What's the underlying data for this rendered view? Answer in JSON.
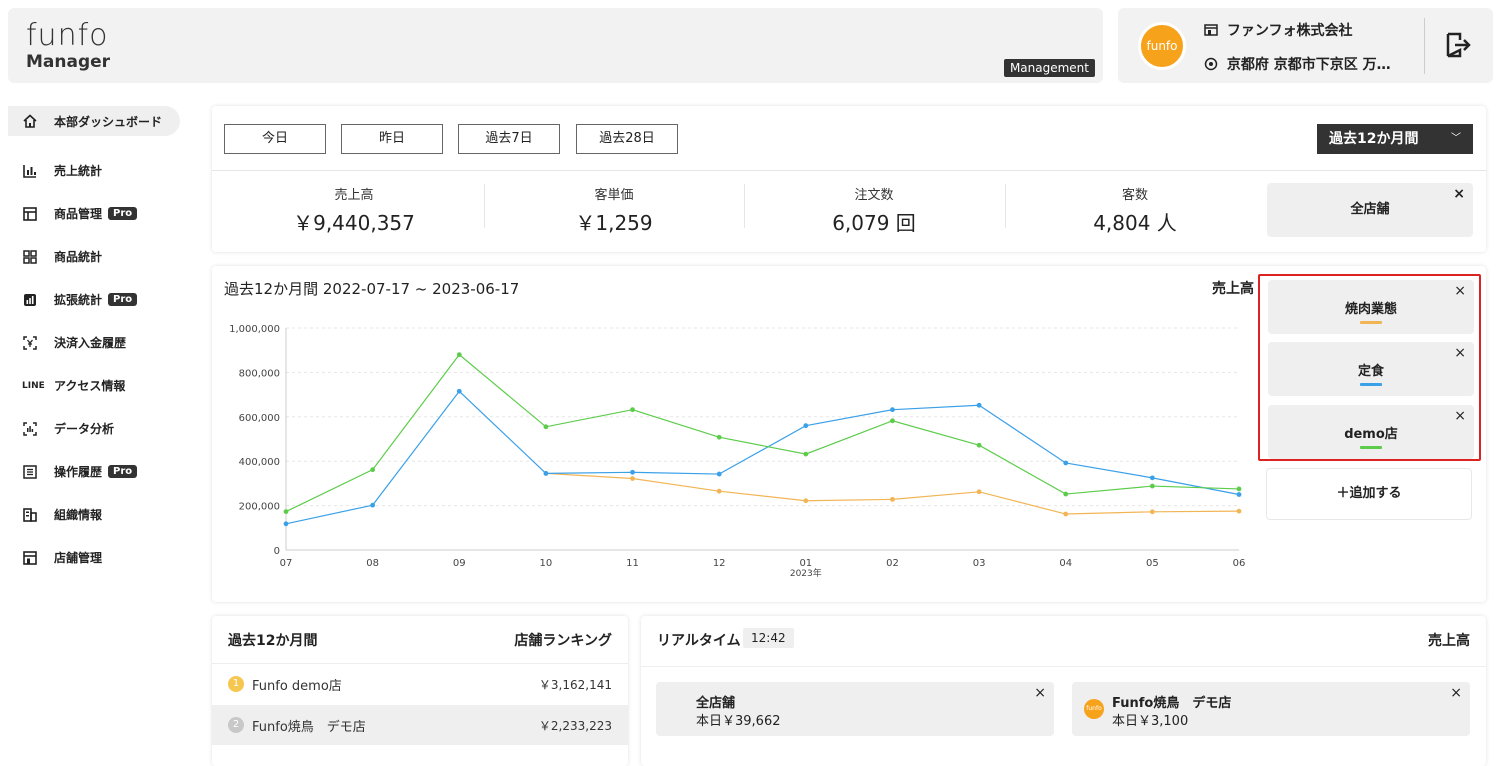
{
  "header": {
    "logo_word": "funfo",
    "logo_sub": "Manager",
    "mode_badge": "Management",
    "avatar_text": "funfo",
    "company": "ファンフォ株式会社",
    "address": "京都府 京都市下京区 万…"
  },
  "sidebar": {
    "items": [
      {
        "label": "本部ダッシュボード",
        "icon": "home-icon",
        "active": true
      },
      {
        "label": "売上統計",
        "icon": "bar-chart-icon"
      },
      {
        "label": "商品管理",
        "icon": "layout-icon",
        "badge": "Pro"
      },
      {
        "label": "商品統計",
        "icon": "grid-icon"
      },
      {
        "label": "拡張統計",
        "icon": "stats-icon",
        "badge": "Pro"
      },
      {
        "label": "決済入金履歴",
        "icon": "payment-icon"
      },
      {
        "label": "アクセス情報",
        "icon": "line-icon",
        "icon_text": "LINE"
      },
      {
        "label": "データ分析",
        "icon": "scan-icon"
      },
      {
        "label": "操作履歴",
        "icon": "list-icon",
        "badge": "Pro"
      },
      {
        "label": "組織情報",
        "icon": "building-icon"
      },
      {
        "label": "店舗管理",
        "icon": "store-icon"
      }
    ]
  },
  "summary": {
    "periods": [
      "今日",
      "昨日",
      "過去7日",
      "過去28日"
    ],
    "selected_period": "過去12か月間",
    "kpis": [
      {
        "label": "売上高",
        "value": "￥9,440,357"
      },
      {
        "label": "客単価",
        "value": "￥1,259"
      },
      {
        "label": "注文数",
        "value": "6,079 回"
      },
      {
        "label": "客数",
        "value": "4,804 人"
      }
    ],
    "store_chip": "全店舗",
    "close": "×"
  },
  "chart_card": {
    "title": "過去12か月間 2022-07-17 ~ 2023-06-17",
    "metric": "売上高",
    "filters": [
      {
        "name": "焼肉業態",
        "color": "#f2b555"
      },
      {
        "name": "定食",
        "color": "#3aa0e8"
      },
      {
        "name": "demo店",
        "color": "#5ccc4a"
      }
    ],
    "add_label": "＋追加する",
    "close": "×"
  },
  "chart_data": {
    "type": "line",
    "categories": [
      "07",
      "08",
      "09",
      "10",
      "11",
      "12",
      "01",
      "02",
      "03",
      "04",
      "05",
      "06"
    ],
    "year_label": "2023年",
    "ylim": [
      0,
      1000000
    ],
    "yticks": [
      "0",
      "200,000",
      "400,000",
      "600,000",
      "800,000",
      "1,000,000"
    ],
    "ytick_values": [
      0,
      200000,
      400000,
      600000,
      800000,
      1000000
    ],
    "series": [
      {
        "color": "#f2b555",
        "values": [
          null,
          null,
          null,
          345000,
          322000,
          265000,
          222000,
          228000,
          262000,
          162000,
          172000,
          175000
        ]
      },
      {
        "color": "#3aa0e8",
        "values": [
          118000,
          202000,
          715000,
          345000,
          350000,
          342000,
          560000,
          632000,
          652000,
          392000,
          325000,
          250000
        ]
      },
      {
        "color": "#5ccc4a",
        "values": [
          173000,
          362000,
          880000,
          555000,
          632000,
          508000,
          432000,
          582000,
          472000,
          252000,
          288000,
          275000
        ]
      }
    ],
    "grid": true
  },
  "ranking": {
    "period": "過去12か月間",
    "title": "店舗ランキング",
    "rows": [
      {
        "rank": "1",
        "name": "Funfo demo店",
        "amount": "￥3,162,141",
        "badge_color": "#f6c750"
      },
      {
        "rank": "2",
        "name": "Funfo焼鳥　デモ店",
        "amount": "￥2,233,223",
        "badge_color": "#c8c8c8"
      }
    ]
  },
  "realtime": {
    "title": "リアルタイム",
    "time": "12:42",
    "metric": "売上高",
    "chips": [
      {
        "name": "全店舗",
        "amount": "本日￥39,662"
      },
      {
        "name": "Funfo焼鳥　デモ店",
        "amount": "本日￥3,100",
        "logo": "funfo"
      }
    ],
    "close": "×"
  }
}
